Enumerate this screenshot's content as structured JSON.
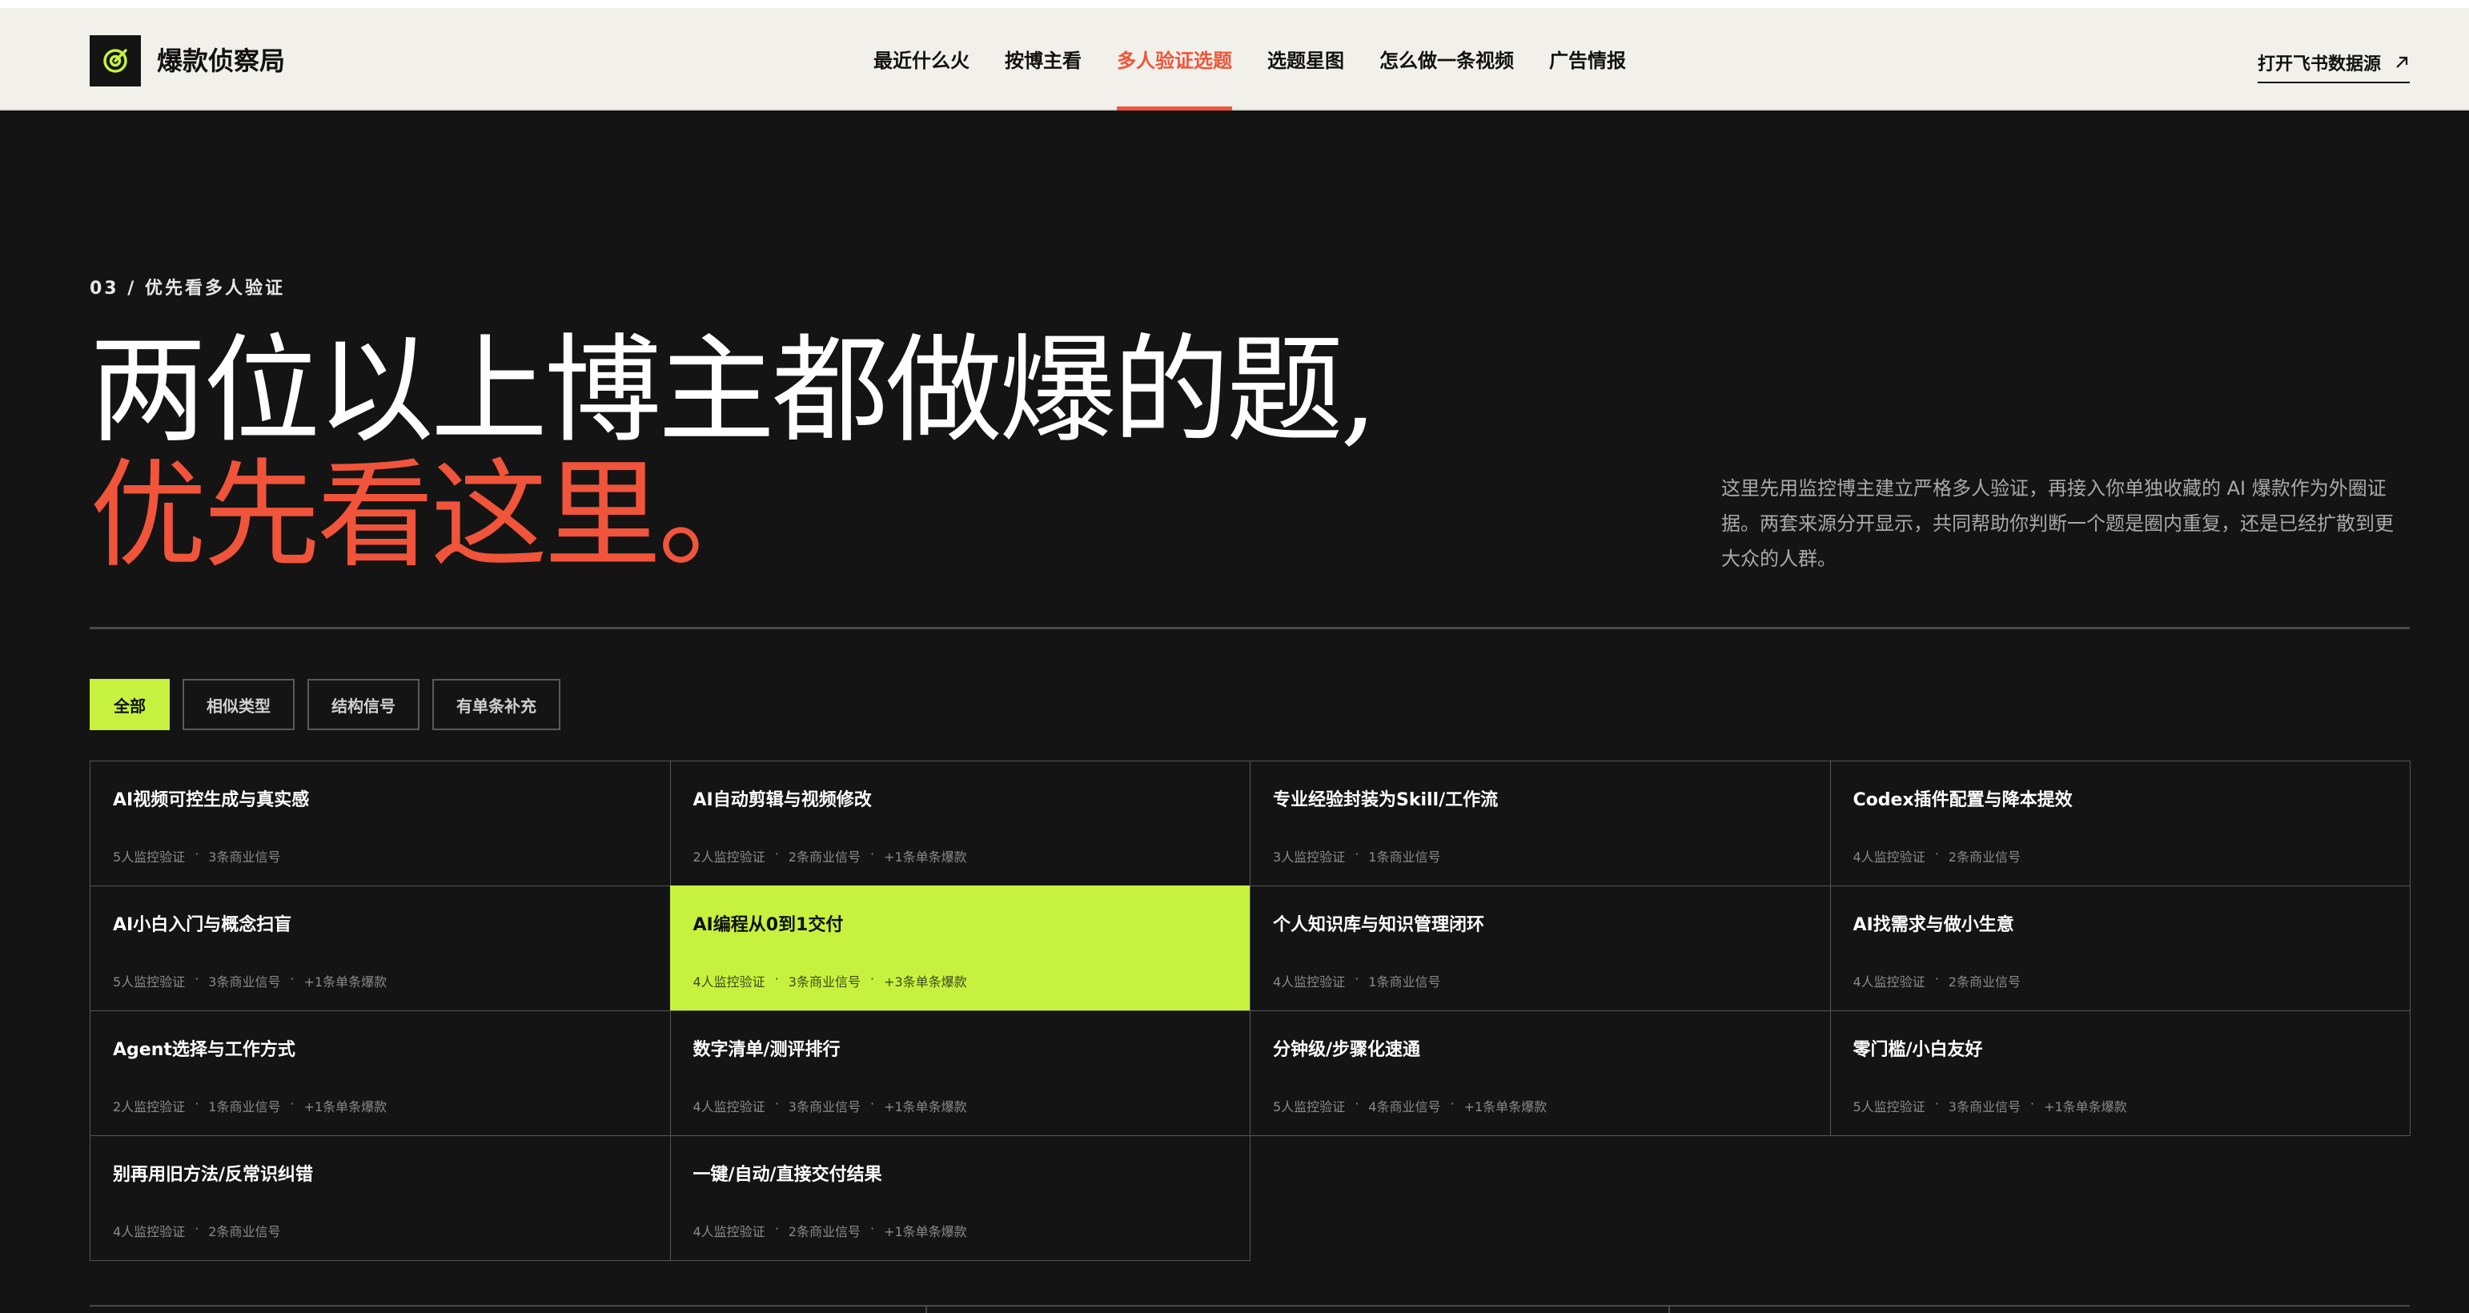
{
  "brand": {
    "name": "爆款侦察局",
    "logo_icon": "target-icon"
  },
  "nav": {
    "items": [
      {
        "label": "最近什么火"
      },
      {
        "label": "按博主看"
      },
      {
        "label": "多人验证选题",
        "active": true
      },
      {
        "label": "选题星图"
      },
      {
        "label": "怎么做一条视频"
      },
      {
        "label": "广告情报"
      }
    ],
    "cta_label": "打开飞书数据源",
    "cta_icon": "arrow-up-right-icon"
  },
  "hero": {
    "eyebrow": "03 / 优先看多人验证",
    "title_line1": "两位以上博主都做爆的题,",
    "title_line2": "优先看这里。",
    "intro": "这里先用监控博主建立严格多人验证，再接入你单独收藏的 AI 爆款作为外圈证据。两套来源分开显示，共同帮助你判断一个题是圈内重复，还是已经扩散到更大众的人群。"
  },
  "filters": [
    {
      "label": "全部",
      "active": true
    },
    {
      "label": "相似类型"
    },
    {
      "label": "结构信号"
    },
    {
      "label": "有单条补充"
    }
  ],
  "cards": [
    {
      "title": "AI视频可控生成与真实感",
      "meta": [
        "5人监控验证",
        "3条商业信号"
      ]
    },
    {
      "title": "AI自动剪辑与视频修改",
      "meta": [
        "2人监控验证",
        "2条商业信号",
        "+1条单条爆款"
      ]
    },
    {
      "title": "专业经验封装为Skill/工作流",
      "meta": [
        "3人监控验证",
        "1条商业信号"
      ]
    },
    {
      "title": "Codex插件配置与降本提效",
      "meta": [
        "4人监控验证",
        "2条商业信号"
      ]
    },
    {
      "title": "AI小白入门与概念扫盲",
      "meta": [
        "5人监控验证",
        "3条商业信号",
        "+1条单条爆款"
      ]
    },
    {
      "title": "AI编程从0到1交付",
      "meta": [
        "4人监控验证",
        "3条商业信号",
        "+3条单条爆款"
      ],
      "highlight": true
    },
    {
      "title": "个人知识库与知识管理闭环",
      "meta": [
        "4人监控验证",
        "1条商业信号"
      ]
    },
    {
      "title": "AI找需求与做小生意",
      "meta": [
        "4人监控验证",
        "2条商业信号"
      ]
    },
    {
      "title": "Agent选择与工作方式",
      "meta": [
        "2人监控验证",
        "1条商业信号",
        "+1条单条爆款"
      ]
    },
    {
      "title": "数字清单/测评排行",
      "meta": [
        "4人监控验证",
        "3条商业信号",
        "+1条单条爆款"
      ]
    },
    {
      "title": "分钟级/步骤化速通",
      "meta": [
        "5人监控验证",
        "4条商业信号",
        "+1条单条爆款"
      ]
    },
    {
      "title": "零门槛/小白友好",
      "meta": [
        "5人监控验证",
        "3条商业信号",
        "+1条单条爆款"
      ]
    },
    {
      "title": "别再用旧方法/反常识纠错",
      "meta": [
        "4人监控验证",
        "2条商业信号"
      ]
    },
    {
      "title": "一键/自动/直接交付结果",
      "meta": [
        "4人监控验证",
        "2条商业信号",
        "+1条单条爆款"
      ]
    }
  ],
  "colors": {
    "accent": "#f0543a",
    "highlight": "#c6f23f",
    "background": "#141414",
    "nav_bg": "#f1f0ea"
  }
}
